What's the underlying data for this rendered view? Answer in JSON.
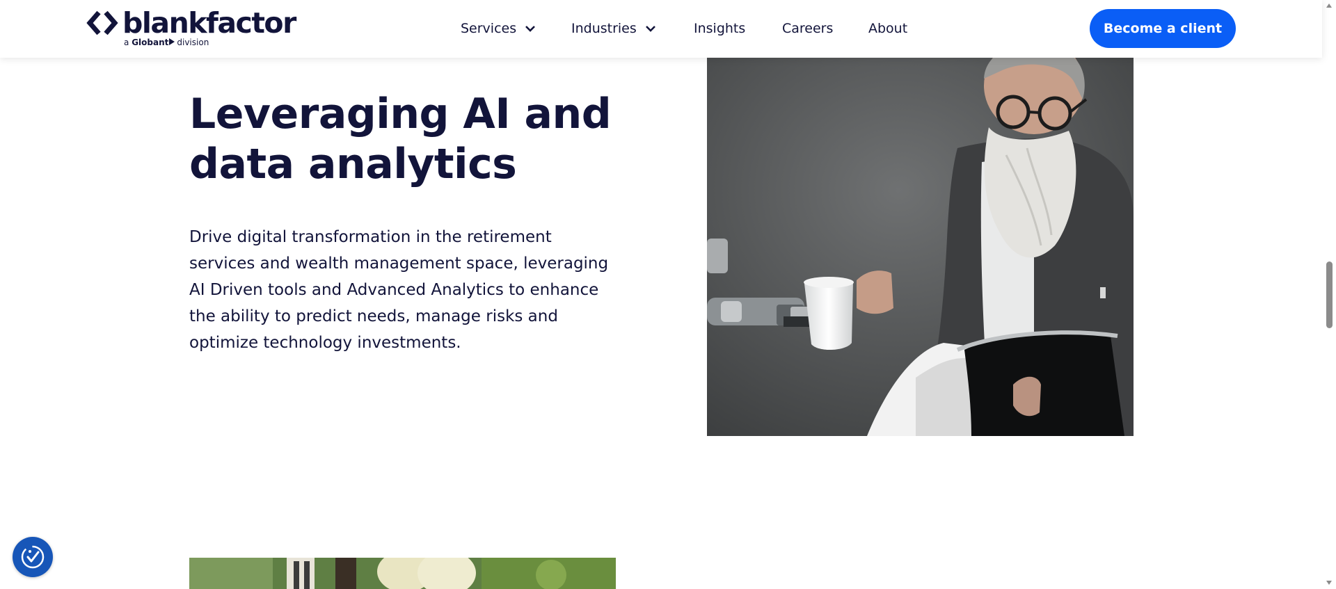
{
  "header": {
    "logo": {
      "wordmark": "blankfactor",
      "sub_prefix": "a",
      "sub_brand": "Globant",
      "sub_suffix": "division"
    },
    "nav": [
      {
        "label": "Services",
        "has_dropdown": true
      },
      {
        "label": "Industries",
        "has_dropdown": true
      },
      {
        "label": "Insights",
        "has_dropdown": false
      },
      {
        "label": "Careers",
        "has_dropdown": false
      },
      {
        "label": "About",
        "has_dropdown": false
      }
    ],
    "cta_label": "Become a client"
  },
  "section": {
    "headline_line1": "Leveraging AI and",
    "headline_line2": "data analytics",
    "body": "Drive digital transformation in the retirement services and wealth management space, leveraging AI Driven tools and Advanced Analytics to enhance the ability to predict needs, manage risks and optimize technology investments."
  },
  "colors": {
    "brand_navy": "#12143a",
    "cta_blue": "#0a5ef6",
    "accessibility_blue": "#1756b8",
    "background": "#ffffff"
  },
  "icons": {
    "logo": "code-brackets-icon",
    "dropdown": "chevron-down-icon",
    "accessibility": "accessibility-check-icon",
    "scroll_up": "triangle-up-icon",
    "scroll_down": "triangle-down-icon"
  }
}
